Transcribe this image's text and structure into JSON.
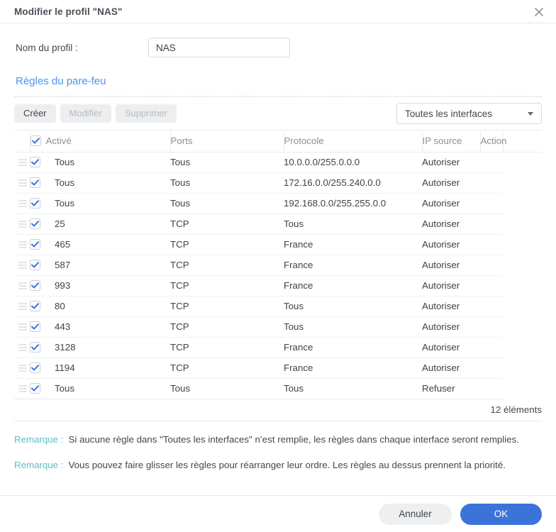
{
  "titlebar": {
    "title": "Modifier le profil \"NAS\"",
    "close_icon": "close-icon"
  },
  "profile": {
    "label": "Nom du profil :",
    "value": "NAS",
    "placeholder": ""
  },
  "section": {
    "title": "Règles du pare-feu"
  },
  "toolbar": {
    "create_label": "Créer",
    "edit_label": "Modifier",
    "delete_label": "Supprimer",
    "interface_select": {
      "value": "Toutes les interfaces",
      "caret_icon": "chevron-down-icon"
    }
  },
  "table": {
    "columns": [
      "",
      "Activé",
      "Ports",
      "Protocole",
      "IP source",
      "Action"
    ],
    "header_checkbox_checked": true,
    "rows": [
      {
        "enabled": true,
        "ports": "Tous",
        "protocol": "Tous",
        "ip": "10.0.0.0/255.0.0.0",
        "action": "Autoriser"
      },
      {
        "enabled": true,
        "ports": "Tous",
        "protocol": "Tous",
        "ip": "172.16.0.0/255.240.0.0",
        "action": "Autoriser"
      },
      {
        "enabled": true,
        "ports": "Tous",
        "protocol": "Tous",
        "ip": "192.168.0.0/255.255.0.0",
        "action": "Autoriser"
      },
      {
        "enabled": true,
        "ports": "25",
        "protocol": "TCP",
        "ip": "Tous",
        "action": "Autoriser"
      },
      {
        "enabled": true,
        "ports": "465",
        "protocol": "TCP",
        "ip": "France",
        "action": "Autoriser"
      },
      {
        "enabled": true,
        "ports": "587",
        "protocol": "TCP",
        "ip": "France",
        "action": "Autoriser"
      },
      {
        "enabled": true,
        "ports": "993",
        "protocol": "TCP",
        "ip": "France",
        "action": "Autoriser"
      },
      {
        "enabled": true,
        "ports": "80",
        "protocol": "TCP",
        "ip": "Tous",
        "action": "Autoriser"
      },
      {
        "enabled": true,
        "ports": "443",
        "protocol": "TCP",
        "ip": "Tous",
        "action": "Autoriser"
      },
      {
        "enabled": true,
        "ports": "3128",
        "protocol": "TCP",
        "ip": "France",
        "action": "Autoriser"
      },
      {
        "enabled": true,
        "ports": "1194",
        "protocol": "TCP",
        "ip": "France",
        "action": "Autoriser"
      },
      {
        "enabled": true,
        "ports": "Tous",
        "protocol": "Tous",
        "ip": "Tous",
        "action": "Refuser"
      }
    ],
    "count_text": "12 éléments"
  },
  "notes": [
    {
      "label": "Remarque :",
      "text": "Si aucune règle dans \"Toutes les interfaces\" n’est remplie, les règles dans chaque interface seront remplies."
    },
    {
      "label": "Remarque :",
      "text": "Vous pouvez faire glisser les règles pour réarranger leur ordre. Les règles au dessus prennent la priorité."
    }
  ],
  "footer": {
    "cancel_label": "Annuler",
    "ok_label": "OK"
  },
  "colors": {
    "accent_link": "#4b93f0",
    "primary_button": "#3c73d9",
    "checkbox_check": "#3c73d9",
    "note_label": "#5bbfc4"
  }
}
